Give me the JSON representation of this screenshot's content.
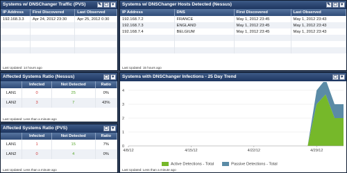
{
  "colors": {
    "active": "#76b82a",
    "passive": "#5b8ba6",
    "header": "#1d3560"
  },
  "pvs": {
    "title": "Systems w/ DNSChanger Traffic (PVS)",
    "columns": [
      "IP Address",
      "First Discovered",
      "Last Observed"
    ],
    "rows": [
      [
        "192.168.3.3",
        "Apr 24, 2012 23:30",
        "Apr 25, 2012 0:30"
      ]
    ],
    "footer": "Last Updated: 14 hours ago"
  },
  "nessus": {
    "title": "Systems w/ DNSChanger Hosts Detected (Nessus)",
    "columns": [
      "IP Address",
      "DNS",
      "First Discovered",
      "Last Observed"
    ],
    "rows": [
      [
        "192.168.7.2",
        "FRANCE",
        "May 1, 2012 23:45",
        "May 1, 2012 23:43"
      ],
      [
        "192.168.7.3",
        "ENGLAND",
        "May 1, 2012 23:45",
        "May 1, 2012 23:43"
      ],
      [
        "192.168.7.4",
        "BELGIUM",
        "May 1, 2012 23:45",
        "May 1, 2012 23:43"
      ]
    ],
    "footer": "Last Updated: 15 hours ago"
  },
  "ratio_nessus": {
    "title": "Affected Systems Ratio (Nessus)",
    "columns": [
      "",
      "Infected",
      "Not Detected",
      "Ratio"
    ],
    "rows": [
      [
        "LAN1",
        "0",
        "25",
        "0%"
      ],
      [
        "LAN2",
        "3",
        "7",
        "43%"
      ]
    ],
    "footer": "Last Updated: Less than a minute ago"
  },
  "ratio_pvs": {
    "title": "Affected Systems Ratio (PVS)",
    "columns": [
      "",
      "Infected",
      "Not Detected",
      "Ratio"
    ],
    "rows": [
      [
        "LAN1",
        "1",
        "15",
        "7%"
      ],
      [
        "LAN2",
        "0",
        "4",
        "0%"
      ]
    ],
    "footer": "Last Updated: Less than a minute ago"
  },
  "trend": {
    "title": "Systems with DNSChanger Infections - 25 Day Trend",
    "footer": "Last Updated: Less than a minute ago",
    "legend": [
      "Active Detections - Total",
      "Passive Detections - Total"
    ]
  },
  "chart_data": {
    "type": "area",
    "x": [
      "4/8/12",
      "4/9/12",
      "4/10/12",
      "4/11/12",
      "4/12/12",
      "4/13/12",
      "4/14/12",
      "4/15/12",
      "4/16/12",
      "4/17/12",
      "4/18/12",
      "4/19/12",
      "4/20/12",
      "4/21/12",
      "4/22/12",
      "4/23/12",
      "4/24/12",
      "4/25/12",
      "4/26/12",
      "4/27/12",
      "4/28/12",
      "4/29/12",
      "4/30/12",
      "5/1/12",
      "5/2/12"
    ],
    "xticks": [
      "4/8/12",
      "4/15/12",
      "4/22/12",
      "4/29/12"
    ],
    "yticks": [
      0,
      1,
      2,
      3,
      4
    ],
    "ylim": [
      0,
      4.3
    ],
    "series": [
      {
        "name": "Active Detections - Total",
        "values": [
          0,
          0,
          0,
          0,
          0,
          0,
          0,
          0,
          0,
          0,
          0,
          0,
          0,
          0,
          0,
          0,
          0,
          0,
          0,
          0,
          0,
          3,
          3.7,
          2,
          2
        ]
      },
      {
        "name": "Passive Detections - Total",
        "values": [
          0,
          0,
          0,
          0,
          0,
          0,
          0,
          0,
          0,
          0,
          0,
          0,
          0,
          0,
          0,
          0,
          0,
          0,
          0,
          0,
          0,
          1,
          1.1,
          1,
          1
        ]
      }
    ]
  }
}
